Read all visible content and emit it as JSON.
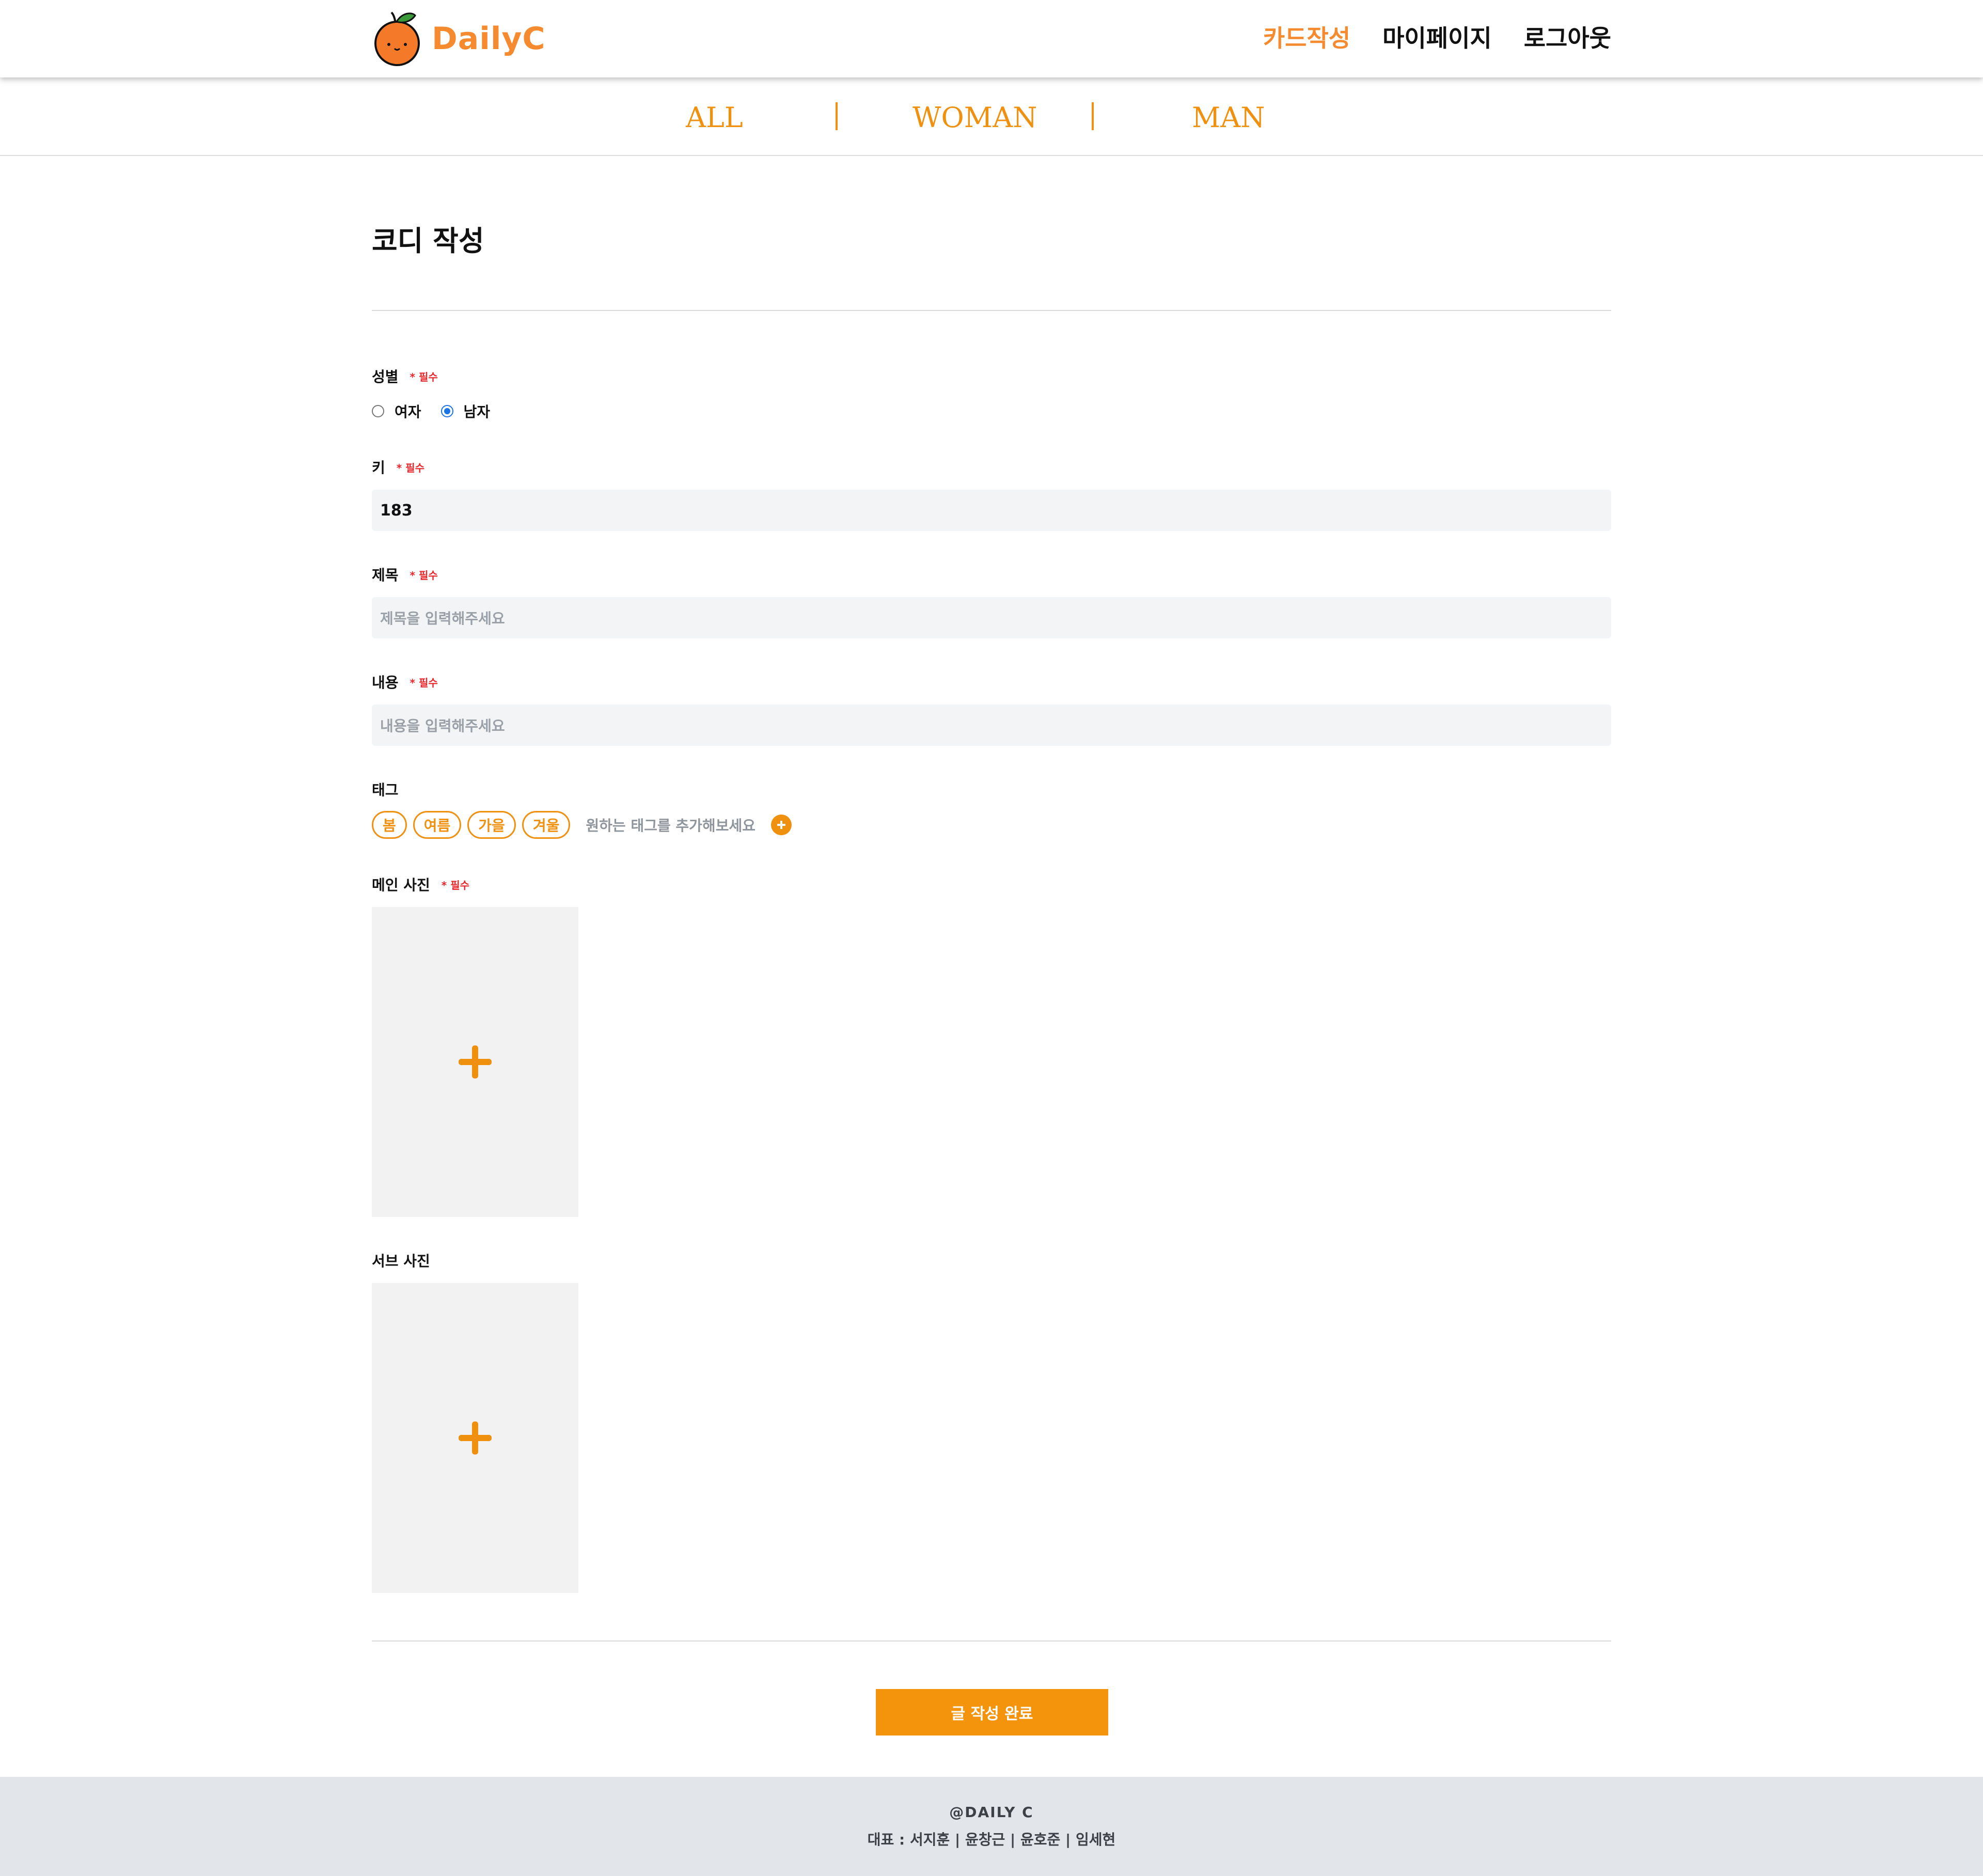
{
  "header": {
    "logo_text": "DailyC",
    "nav": [
      {
        "label": "카드작성",
        "active": true
      },
      {
        "label": "마이페이지",
        "active": false
      },
      {
        "label": "로그아웃",
        "active": false
      }
    ]
  },
  "categories": [
    "ALL",
    "WOMAN",
    "MAN"
  ],
  "page_title": "코디 작성",
  "required_mark": "* 필수",
  "gender": {
    "label": "성별",
    "options": [
      "여자",
      "남자"
    ],
    "selected": "남자"
  },
  "height": {
    "label": "키",
    "value": "183"
  },
  "title_field": {
    "label": "제목",
    "placeholder": "제목을 입력해주세요"
  },
  "content_field": {
    "label": "내용",
    "placeholder": "내용을 입력해주세요"
  },
  "tags": {
    "label": "태그",
    "items": [
      "봄",
      "여름",
      "가을",
      "겨울"
    ],
    "hint": "원하는 태그를 추가해보세요"
  },
  "main_photo": {
    "label": "메인 사진"
  },
  "sub_photo": {
    "label": "서브 사진"
  },
  "submit_label": "글 작성 완료",
  "footer": {
    "brand": "@DAILY C",
    "team": "대표 : 서지훈 | 윤창근 | 윤호준 | 임세현"
  },
  "colors": {
    "accent": "#f0900f",
    "logo": "#f58a2e",
    "required": "#e8262c",
    "field_bg": "#f3f4f6",
    "footer_bg": "#e2e5ea"
  }
}
